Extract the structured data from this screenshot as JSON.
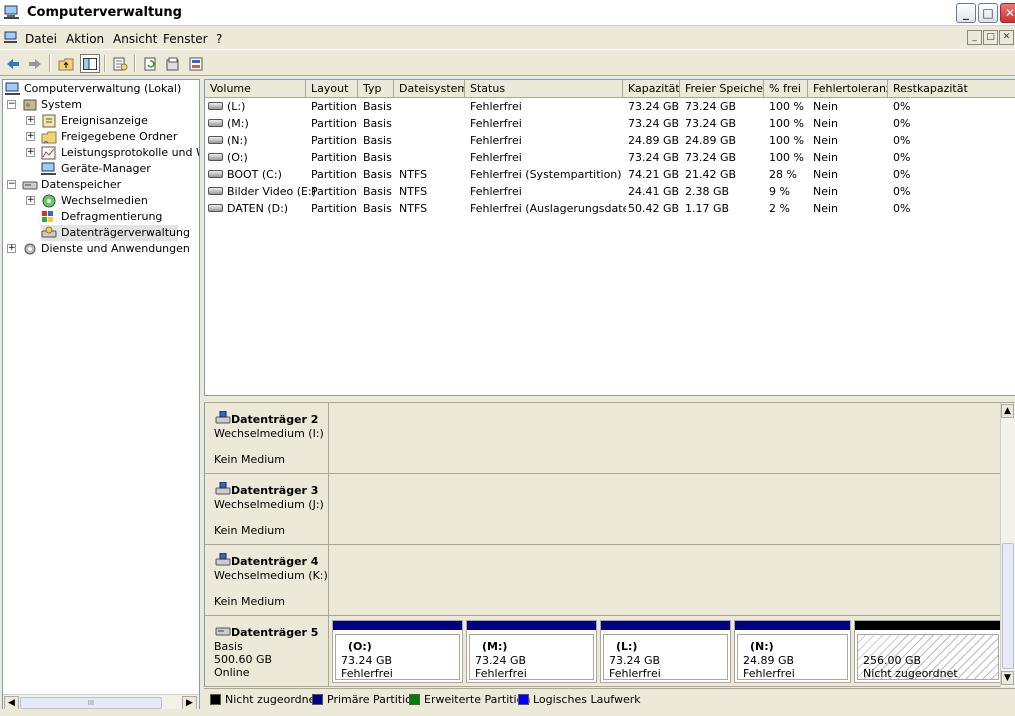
{
  "window": {
    "title": "Computerverwaltung"
  },
  "menu": [
    "Datei",
    "Aktion",
    "Ansicht",
    "Fenster",
    "?"
  ],
  "toolbar": [
    "back-icon",
    "forward-icon",
    "up-folder-icon",
    "show-hide-tree-icon",
    "properties-icon",
    "refresh-icon",
    "export-icon",
    "help-icon"
  ],
  "tree": {
    "root": "Computerverwaltung (Lokal)",
    "system": "System",
    "ereignis": "Ereignisanzeige",
    "ordner": "Freigegebene Ordner",
    "leistung": "Leistungsprotokolle und Warn",
    "geraete": "Geräte-Manager",
    "datenspeicher": "Datenspeicher",
    "wechsel": "Wechselmedien",
    "defrag": "Defragmentierung",
    "dtv": "Datenträgerverwaltung",
    "dienste": "Dienste und Anwendungen",
    "scroll_grip": "III"
  },
  "volumes": {
    "columns": [
      "Volume",
      "Layout",
      "Typ",
      "Dateisystem",
      "Status",
      "Kapazität",
      "Freier Speicher",
      "% frei",
      "Fehlertoleranz",
      "Restkapazität"
    ],
    "rows": [
      [
        "(L:)",
        "Partition",
        "Basis",
        "",
        "Fehlerfrei",
        "73.24 GB",
        "73.24 GB",
        "100 %",
        "Nein",
        "0%"
      ],
      [
        "(M:)",
        "Partition",
        "Basis",
        "",
        "Fehlerfrei",
        "73.24 GB",
        "73.24 GB",
        "100 %",
        "Nein",
        "0%"
      ],
      [
        "(N:)",
        "Partition",
        "Basis",
        "",
        "Fehlerfrei",
        "24.89 GB",
        "24.89 GB",
        "100 %",
        "Nein",
        "0%"
      ],
      [
        "(O:)",
        "Partition",
        "Basis",
        "",
        "Fehlerfrei",
        "73.24 GB",
        "73.24 GB",
        "100 %",
        "Nein",
        "0%"
      ],
      [
        "BOOT (C:)",
        "Partition",
        "Basis",
        "NTFS",
        "Fehlerfrei (Systempartition)",
        "74.21 GB",
        "21.42 GB",
        "28 %",
        "Nein",
        "0%"
      ],
      [
        "Bilder Video (E:)",
        "Partition",
        "Basis",
        "NTFS",
        "Fehlerfrei",
        "24.41 GB",
        "2.38 GB",
        "9 %",
        "Nein",
        "0%"
      ],
      [
        "DATEN (D:)",
        "Partition",
        "Basis",
        "NTFS",
        "Fehlerfrei (Auslagerungsdatei)",
        "50.42 GB",
        "1.17 GB",
        "2 %",
        "Nein",
        "0%"
      ]
    ]
  },
  "disks": {
    "d2": {
      "title": "Datenträger 2",
      "type": "Wechselmedium (I:)",
      "status": "Kein Medium"
    },
    "d3": {
      "title": "Datenträger 3",
      "type": "Wechselmedium (J:)",
      "status": "Kein Medium"
    },
    "d4": {
      "title": "Datenträger 4",
      "type": "Wechselmedium (K:)",
      "status": "Kein Medium"
    },
    "d5": {
      "title": "Datenträger 5",
      "type": "Basis",
      "size": "500.60 GB",
      "status": "Online",
      "partitions": [
        {
          "name": "(O:)",
          "size": "73.24 GB",
          "status": "Fehlerfrei"
        },
        {
          "name": "(M:)",
          "size": "73.24 GB",
          "status": "Fehlerfrei"
        },
        {
          "name": "(L:)",
          "size": "73.24 GB",
          "status": "Fehlerfrei"
        },
        {
          "name": "(N:)",
          "size": "24.89 GB",
          "status": "Fehlerfrei"
        },
        {
          "name": "",
          "size": "256.00 GB",
          "status": "Nicht zugeordnet"
        }
      ]
    }
  },
  "legend": [
    {
      "label": "Nicht zugeordnet",
      "color": "#000000"
    },
    {
      "label": "Primäre Partition",
      "color": "#000080"
    },
    {
      "label": "Erweiterte Partition",
      "color": "#008000"
    },
    {
      "label": "Logisches Laufwerk",
      "color": "#0000ff"
    }
  ]
}
